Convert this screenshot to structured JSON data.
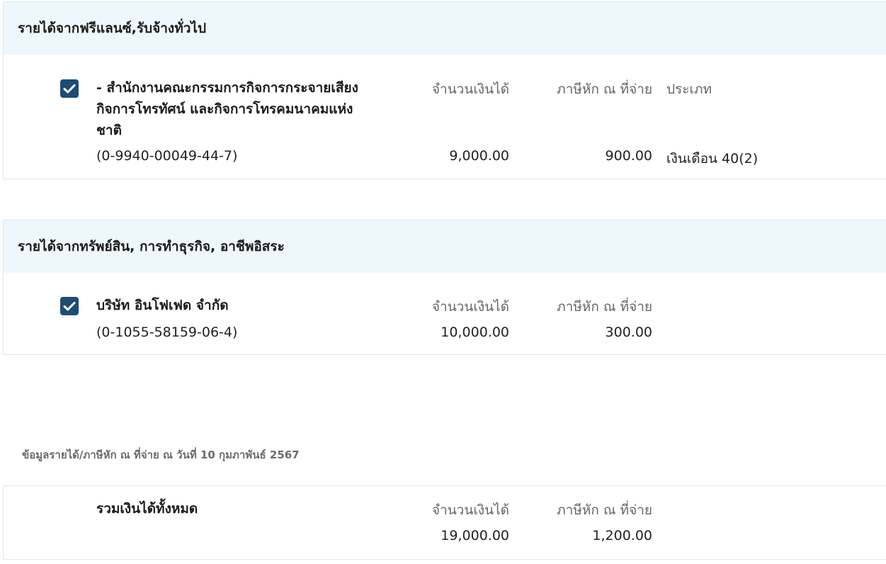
{
  "sections": [
    {
      "title": "รายได้จากฟรีแลนซ์,รับจ้างทั่วไป",
      "payer_name": "- สำนักงานคณะกรรมการกิจการกระจายเสียง กิจการโทรทัศน์ และกิจการโทรคมนาคมแห่งชาติ",
      "payer_taxid": "(0-9940-00049-44-7)",
      "col_income": "จำนวนเงินได้",
      "col_tax": "ภาษีหัก ณ ที่จ่าย",
      "col_type": "ประเภท",
      "income": "9,000.00",
      "tax": "900.00",
      "type": "เงินเดือน 40(2)",
      "checked": true
    },
    {
      "title": "รายได้จากทรัพย์สิน, การทำธุรกิจ, อาชีพอิสระ",
      "payer_name": "บริษัท อินโฟเฟด จำกัด",
      "payer_taxid": "(0-1055-58159-06-4)",
      "col_income": "จำนวนเงินได้",
      "col_tax": "ภาษีหัก ณ ที่จ่าย",
      "income": "10,000.00",
      "tax": "300.00",
      "checked": true
    }
  ],
  "note": "ข้อมูลรายได้/ภาษีหัก ณ ที่จ่าย ณ วันที่ 10 กุมภาพันธ์ 2567",
  "total": {
    "label": "รวมเงินได้ทั้งหมด",
    "col_income": "จำนวนเงินได้",
    "col_tax": "ภาษีหัก ณ ที่จ่าย",
    "income": "19,000.00",
    "tax": "1,200.00"
  },
  "colors": {
    "header_bg": "#eef7fb",
    "checkbox": "#1d4d73"
  },
  "icons": [
    "checkmark-icon"
  ]
}
